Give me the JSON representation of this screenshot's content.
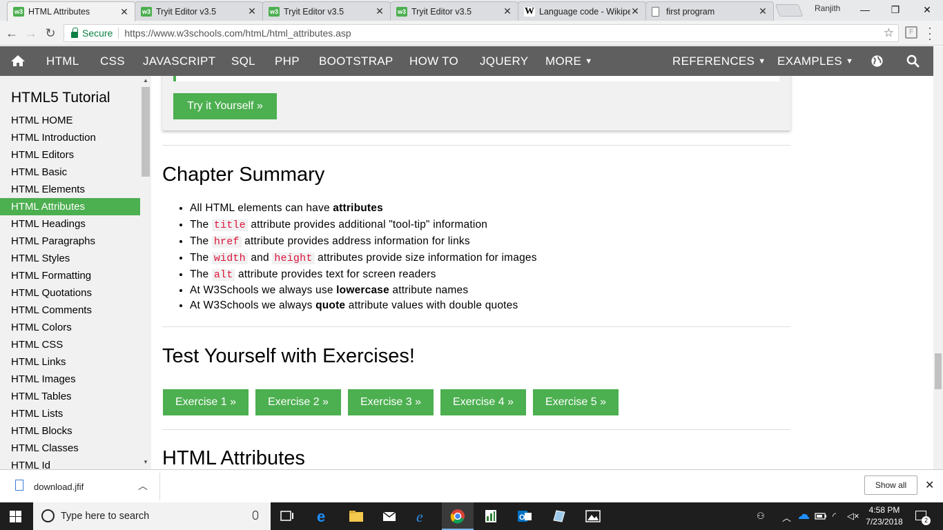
{
  "browser": {
    "tabs": [
      {
        "title": "HTML Attributes",
        "favicon": "w3-icon",
        "active": true
      },
      {
        "title": "Tryit Editor v3.5",
        "favicon": "w3-icon",
        "active": false
      },
      {
        "title": "Tryit Editor v3.5",
        "favicon": "w3-icon",
        "active": false
      },
      {
        "title": "Tryit Editor v3.5",
        "favicon": "w3-icon",
        "active": false
      },
      {
        "title": "Language code - Wikipe",
        "favicon": "wikipedia-icon",
        "active": false
      },
      {
        "title": "first program",
        "favicon": "document-icon",
        "active": false
      }
    ],
    "user_name": "Ranjith",
    "secure_label": "Secure",
    "url": "https://www.w3schools.com/htmL/html_attributes.asp"
  },
  "w3nav": {
    "items": [
      "HTML",
      "CSS",
      "JAVASCRIPT",
      "SQL",
      "PHP",
      "BOOTSTRAP",
      "HOW TO",
      "JQUERY",
      "MORE"
    ],
    "references": "REFERENCES",
    "examples": "EXAMPLES"
  },
  "sidebar": {
    "title": "HTML5 Tutorial",
    "items": [
      {
        "label": "HTML HOME",
        "active": false
      },
      {
        "label": "HTML Introduction",
        "active": false
      },
      {
        "label": "HTML Editors",
        "active": false
      },
      {
        "label": "HTML Basic",
        "active": false
      },
      {
        "label": "HTML Elements",
        "active": false
      },
      {
        "label": "HTML Attributes",
        "active": true
      },
      {
        "label": "HTML Headings",
        "active": false
      },
      {
        "label": "HTML Paragraphs",
        "active": false
      },
      {
        "label": "HTML Styles",
        "active": false
      },
      {
        "label": "HTML Formatting",
        "active": false
      },
      {
        "label": "HTML Quotations",
        "active": false
      },
      {
        "label": "HTML Comments",
        "active": false
      },
      {
        "label": "HTML Colors",
        "active": false
      },
      {
        "label": "HTML CSS",
        "active": false
      },
      {
        "label": "HTML Links",
        "active": false
      },
      {
        "label": "HTML Images",
        "active": false
      },
      {
        "label": "HTML Tables",
        "active": false
      },
      {
        "label": "HTML Lists",
        "active": false
      },
      {
        "label": "HTML Blocks",
        "active": false
      },
      {
        "label": "HTML Classes",
        "active": false
      },
      {
        "label": "HTML Id",
        "active": false
      }
    ]
  },
  "main": {
    "try_it_label": "Try it Yourself »",
    "summary_heading": "Chapter Summary",
    "summary": {
      "l1_text": "All HTML elements can have ",
      "l1_bold": "attributes",
      "l2_pre": "The ",
      "l2_code": "title",
      "l2_post": " attribute provides additional \"tool-tip\" information",
      "l3_pre": "The ",
      "l3_code": "href",
      "l3_post": " attribute provides address information for links",
      "l4_pre": "The ",
      "l4_code1": "width",
      "l4_mid": " and ",
      "l4_code2": "height",
      "l4_post": " attributes provide size information for images",
      "l5_pre": "The ",
      "l5_code": "alt",
      "l5_post": " attribute provides text for screen readers",
      "l6_pre": "At W3Schools we always use ",
      "l6_bold": "lowercase",
      "l6_post": " attribute names",
      "l7_pre": "At W3Schools we always ",
      "l7_bold": "quote",
      "l7_post": " attribute values with double quotes"
    },
    "exercises_heading": "Test Yourself with Exercises!",
    "exercises": [
      "Exercise 1 »",
      "Exercise 2 »",
      "Exercise 3 »",
      "Exercise 4 »",
      "Exercise 5 »"
    ],
    "next_heading": "HTML Attributes"
  },
  "download_shelf": {
    "file_name": "download.jfif",
    "show_all_label": "Show all"
  },
  "taskbar": {
    "search_placeholder": "Type here to search",
    "time": "4:58 PM",
    "date": "7/23/2018",
    "notification_count": "2"
  },
  "colors": {
    "w3_green": "#4CAF50",
    "nav_gray": "#5f5f5f",
    "sidebar_bg": "#f1f1f1",
    "code_red": "#dc143c"
  }
}
